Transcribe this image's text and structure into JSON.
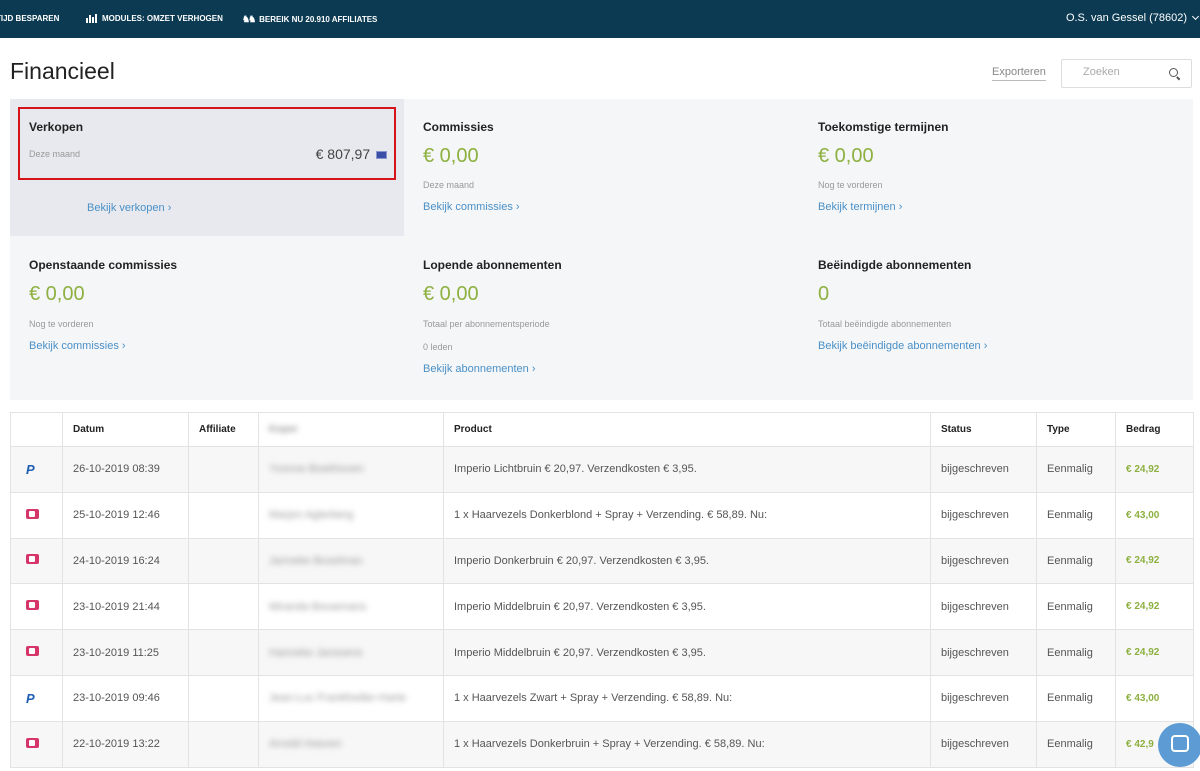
{
  "topbar": {
    "items": [
      "TIJD BESPAREN",
      "MODULES: OMZET VERHOGEN",
      "BEREIK NU 20.910 AFFILIATES"
    ],
    "user": "O.S. van Gessel (78602)"
  },
  "header": {
    "title": "Financieel",
    "export_label": "Exporteren",
    "search_placeholder": "Zoeken"
  },
  "summary": [
    {
      "title": "Verkopen",
      "sub": "Deze maand",
      "value": "€ 807,97",
      "link": "Bekijk verkopen ›"
    },
    {
      "title": "Commissies",
      "value": "€ 0,00",
      "sub": "Deze maand",
      "link": "Bekijk commissies ›"
    },
    {
      "title": "Toekomstige termijnen",
      "value": "€ 0,00",
      "sub": "Nog te vorderen",
      "link": "Bekijk termijnen ›"
    },
    {
      "title": "Openstaande commissies",
      "value": "€ 0,00",
      "sub": "Nog te vorderen",
      "link": "Bekijk commissies ›"
    },
    {
      "title": "Lopende abonnementen",
      "value": "€ 0,00",
      "sub": "Totaal per abonnementsperiode",
      "sub2": "0 leden",
      "link": "Bekijk abonnementen ›"
    },
    {
      "title": "Beëindigde abonnementen",
      "value": "0",
      "sub": "Totaal beëindigde abonnementen",
      "link": "Bekijk beëindigde abonnementen ›"
    }
  ],
  "table": {
    "headers": [
      "Datum",
      "Affiliate",
      "Koper",
      "Product",
      "Status",
      "Type",
      "Bedrag"
    ],
    "rows": [
      {
        "method": "paypal",
        "date": "26-10-2019 08:39",
        "buyer": "Yvonne Boekhoven",
        "product": "Imperio Lichtbruin € 20,97. Verzendkosten € 3,95.",
        "status": "bijgeschreven",
        "type": "Eenmalig",
        "amount": "€ 24,92"
      },
      {
        "method": "ideal",
        "date": "25-10-2019 12:46",
        "buyer": "Marjon Agterberg",
        "product": "1 x Haarvezels Donkerblond + Spray + Verzending. € 58,89. Nu:",
        "status": "bijgeschreven",
        "type": "Eenmalig",
        "amount": "€ 43,00"
      },
      {
        "method": "ideal",
        "date": "24-10-2019 16:24",
        "buyer": "Janneke Boxelman",
        "product": "Imperio Donkerbruin € 20,97. Verzendkosten € 3,95.",
        "status": "bijgeschreven",
        "type": "Eenmalig",
        "amount": "€ 24,92"
      },
      {
        "method": "ideal",
        "date": "23-10-2019 21:44",
        "buyer": "Miranda Bouwmans",
        "product": "Imperio Middelbruin € 20,97. Verzendkosten € 3,95.",
        "status": "bijgeschreven",
        "type": "Eenmalig",
        "amount": "€ 24,92"
      },
      {
        "method": "ideal",
        "date": "23-10-2019 11:25",
        "buyer": "Hanneke Janssens",
        "product": "Imperio Middelbruin € 20,97. Verzendkosten € 3,95.",
        "status": "bijgeschreven",
        "type": "Eenmalig",
        "amount": "€ 24,92"
      },
      {
        "method": "paypal",
        "date": "23-10-2019 09:46",
        "buyer": "Jean-Luc Frankfoeller-Harte",
        "product": "1 x Haarvezels Zwart + Spray + Verzending. € 58,89. Nu:",
        "status": "bijgeschreven",
        "type": "Eenmalig",
        "amount": "€ 43,00"
      },
      {
        "method": "ideal",
        "date": "22-10-2019 13:22",
        "buyer": "Arnold Hoeven",
        "product": "1 x Haarvezels Donkerbruin + Spray + Verzending. € 58,89. Nu:",
        "status": "bijgeschreven",
        "type": "Eenmalig",
        "amount": "€ 42,9"
      }
    ]
  },
  "icons": {
    "paypal": "paypal-icon",
    "ideal": "ideal-icon",
    "search": "search-icon",
    "chat": "chat-icon"
  },
  "colors": {
    "topbar": "#0b3a52",
    "accent_green": "#8db040",
    "link_blue": "#4a90c8",
    "highlight_red": "#d6131b"
  }
}
